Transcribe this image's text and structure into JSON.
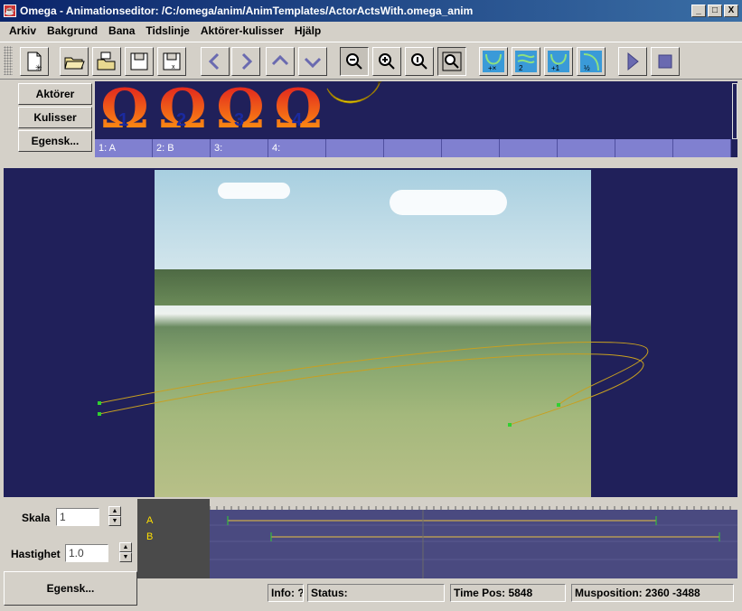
{
  "window": {
    "title": "Omega - Animationseditor: /C:/omega/anim/AnimTemplates/ActorActsWith.omega_anim",
    "minimize": "_",
    "maximize": "□",
    "close": "X"
  },
  "menu": [
    "Arkiv",
    "Bakgrund",
    "Bana",
    "Tidslinje",
    "Aktörer-kulisser",
    "Hjälp"
  ],
  "toolbar": {
    "icons": [
      "new-file-icon",
      "open-folder-icon",
      "open-template-icon",
      "save-icon",
      "save-as-icon",
      "arrow-left-icon",
      "arrow-right-icon",
      "arrow-up-icon",
      "arrow-down-icon",
      "zoom-out-icon",
      "zoom-in-icon",
      "zoom-reset-icon",
      "zoom-fit-icon",
      "path-delete-icon",
      "path-2-icon",
      "path-add-icon",
      "path-half-icon",
      "play-icon",
      "stop-icon"
    ]
  },
  "side_buttons": {
    "actors": "Aktörer",
    "scenery": "Kulisser",
    "properties": "Egensk..."
  },
  "actors": {
    "glyph": "Ω",
    "numbers": [
      "1",
      "2",
      "3",
      "4"
    ],
    "slots": [
      "1: A",
      "2: B",
      "3:",
      "4:",
      "",
      "",
      "",
      "",
      "",
      "",
      ""
    ]
  },
  "controls": {
    "scale_label": "Skala",
    "scale_value": "1",
    "speed_label": "Hastighet",
    "speed_value": "1.0",
    "properties_button": "Egensk..."
  },
  "timeline": {
    "tracks": [
      "A",
      "B"
    ]
  },
  "status": {
    "info": "Info: ?",
    "status": "Status:",
    "time_pos": "Time Pos: 5848",
    "mouse_pos": "Musposition: 2360 -3488"
  },
  "colors": {
    "stage_bg": "#20205a",
    "path": "#c8a020",
    "point": "#30d030",
    "slot": "#8080d0"
  }
}
